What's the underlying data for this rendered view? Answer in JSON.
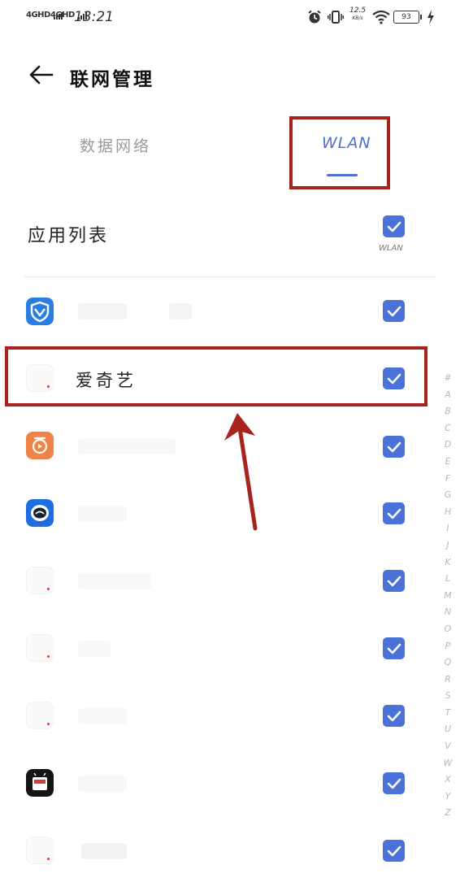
{
  "status_bar": {
    "signal1": "4GHD",
    "signal2": "4GHD",
    "time": "13:21",
    "speed_value": "12.5",
    "speed_unit": "KB/s",
    "battery": "93"
  },
  "header": {
    "title": "联网管理"
  },
  "tabs": [
    {
      "label": "数据网络",
      "active": false
    },
    {
      "label": "WLAN",
      "active": true
    }
  ],
  "list": {
    "title": "应用列表",
    "column_label": "WLAN",
    "all_checked": true
  },
  "apps": [
    {
      "name": "",
      "icon": "tencent-shield-icon",
      "checked": true
    },
    {
      "name": "爱奇艺",
      "icon": "blank-app-icon",
      "checked": true
    },
    {
      "name": "",
      "icon": "orange-app-icon",
      "checked": true
    },
    {
      "name": "",
      "icon": "robot-app-icon",
      "checked": true
    },
    {
      "name": "",
      "icon": "blank-app-icon",
      "checked": true
    },
    {
      "name": "",
      "icon": "blank-app-icon",
      "checked": true
    },
    {
      "name": "",
      "icon": "blank-app-icon",
      "checked": true
    },
    {
      "name": "",
      "icon": "apk-app-icon",
      "checked": true
    },
    {
      "name": "",
      "icon": "blank-app-icon",
      "checked": true
    }
  ],
  "alphabet": [
    "#",
    "A",
    "B",
    "C",
    "D",
    "E",
    "F",
    "G",
    "H",
    "I",
    "J",
    "K",
    "L",
    "M",
    "N",
    "O",
    "P",
    "Q",
    "R",
    "S",
    "T",
    "U",
    "V",
    "W",
    "X",
    "Y",
    "Z"
  ],
  "colors": {
    "accent": "#4a72d8",
    "annotation_red": "#a8231d"
  }
}
